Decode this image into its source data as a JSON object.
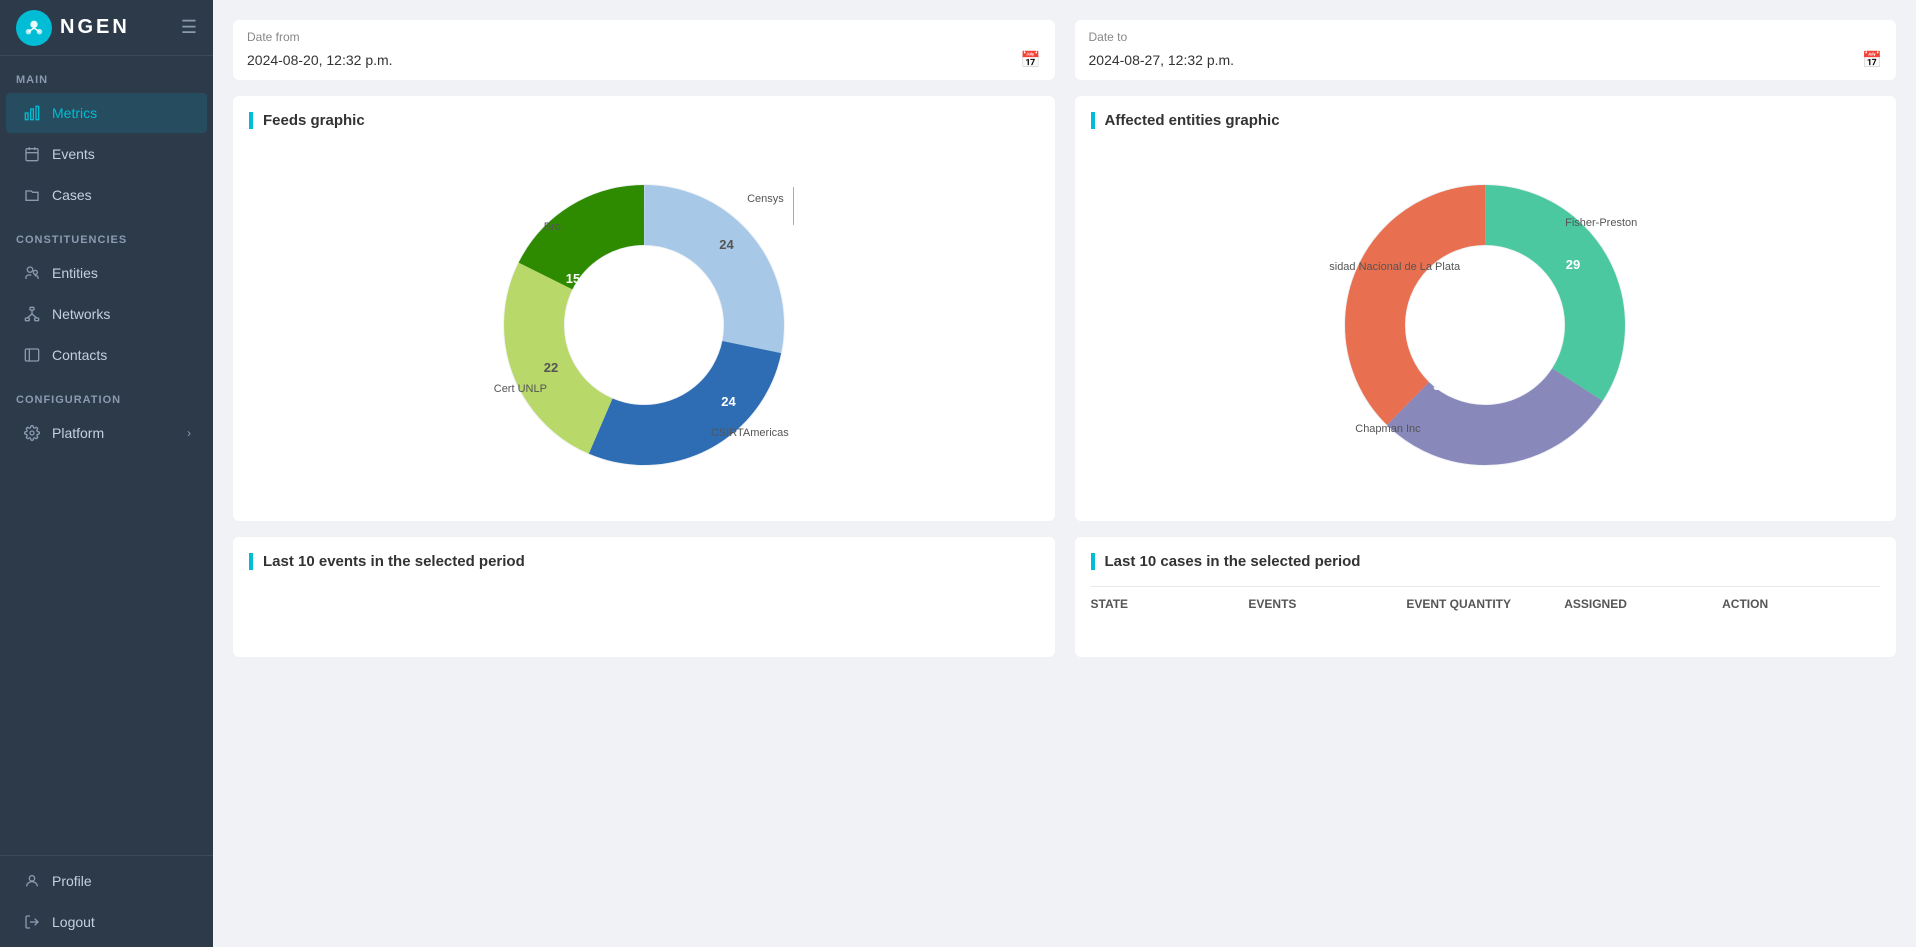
{
  "app": {
    "title": "NGEN",
    "logo_alt": "ngen logo"
  },
  "sidebar": {
    "main_label": "MAIN",
    "constituencies_label": "CONSTITUENCIES",
    "configuration_label": "CONFIGURATION",
    "items_main": [
      {
        "id": "metrics",
        "label": "Metrics",
        "icon": "chart",
        "active": true
      },
      {
        "id": "events",
        "label": "Events",
        "icon": "calendar"
      },
      {
        "id": "cases",
        "label": "Cases",
        "icon": "folder"
      }
    ],
    "items_constituencies": [
      {
        "id": "entities",
        "label": "Entities",
        "icon": "users"
      },
      {
        "id": "networks",
        "label": "Networks",
        "icon": "network"
      },
      {
        "id": "contacts",
        "label": "Contacts",
        "icon": "contact"
      }
    ],
    "items_configuration": [
      {
        "id": "platform",
        "label": "Platform",
        "icon": "settings",
        "has_chevron": true
      }
    ],
    "items_bottom": [
      {
        "id": "profile",
        "label": "Profile",
        "icon": "user"
      },
      {
        "id": "logout",
        "label": "Logout",
        "icon": "logout"
      }
    ]
  },
  "header": {
    "date_from_label": "Date from",
    "date_from_value": "2024-08-20, 12:32 p.m.",
    "date_to_label": "Date to",
    "date_to_value": "2024-08-27, 12:32 p.m."
  },
  "feeds_chart": {
    "title": "Feeds graphic",
    "segments": [
      {
        "label": "Censys",
        "value": 24,
        "color": "#a8c8e8"
      },
      {
        "label": "CSIRTAmericas",
        "value": 24,
        "color": "#2e6db4"
      },
      {
        "label": "Cert UNLP",
        "value": 22,
        "color": "#b8d96a"
      },
      {
        "label": "Bro",
        "value": 15,
        "color": "#2e8b00"
      }
    ]
  },
  "affected_chart": {
    "title": "Affected entities graphic",
    "segments": [
      {
        "label": "Fisher-Preston",
        "value": 29,
        "color": "#4bc8a0"
      },
      {
        "label": "sidad Nacional de La Plata",
        "value": 24,
        "color": "#8888bb"
      },
      {
        "label": "Chapman Inc",
        "value": 32,
        "color": "#e87050"
      }
    ]
  },
  "last_events": {
    "title": "Last 10 events in the selected period"
  },
  "last_cases": {
    "title": "Last 10 cases in the selected period",
    "columns": [
      "State",
      "Events",
      "Event quantity",
      "Assigned",
      "Action"
    ]
  }
}
